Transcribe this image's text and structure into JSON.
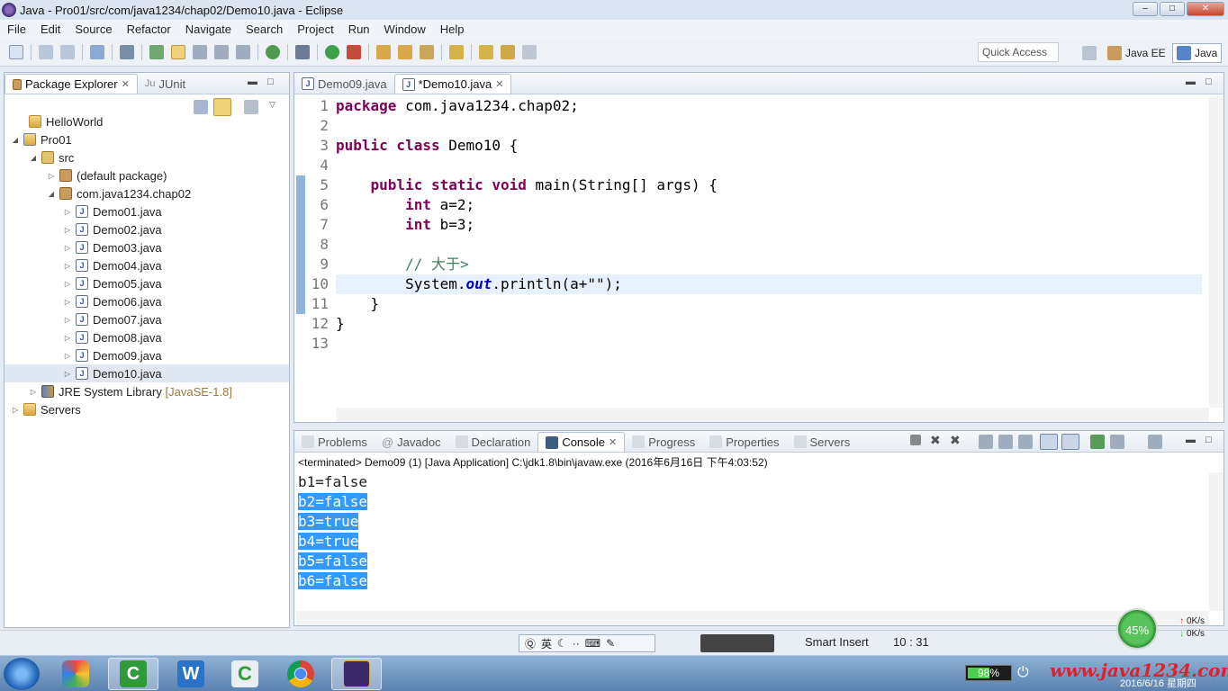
{
  "window": {
    "title": "Java - Pro01/src/com/java1234/chap02/Demo10.java - Eclipse"
  },
  "menu": [
    "File",
    "Edit",
    "Source",
    "Refactor",
    "Navigate",
    "Search",
    "Project",
    "Run",
    "Window",
    "Help"
  ],
  "toolbar": {
    "quick_access": "Quick Access",
    "perspective_javaee": "Java EE",
    "perspective_java": "Java"
  },
  "explorer": {
    "tab_package": "Package Explorer",
    "tab_junit": "JUnit",
    "nodes": {
      "helloworld": "HelloWorld",
      "pro01": "Pro01",
      "src": "src",
      "default_pkg": "(default package)",
      "pkg": "com.java1234.chap02",
      "d01": "Demo01.java",
      "d02": "Demo02.java",
      "d03": "Demo03.java",
      "d04": "Demo04.java",
      "d05": "Demo05.java",
      "d06": "Demo06.java",
      "d07": "Demo07.java",
      "d08": "Demo08.java",
      "d09": "Demo09.java",
      "d10": "Demo10.java",
      "jre": "JRE System Library",
      "jre_ver": "[JavaSE-1.8]",
      "servers": "Servers"
    }
  },
  "editor": {
    "tab1": "Demo09.java",
    "tab2": "*Demo10.java",
    "line_numbers": [
      "1",
      "2",
      "3",
      "4",
      "5",
      "6",
      "7",
      "8",
      "9",
      "10",
      "11",
      "12",
      "13"
    ],
    "code": {
      "l1_kw": "package",
      "l1_rest": " com.java1234.chap02;",
      "l3_kw": "public class",
      "l3_rest": " Demo10 {",
      "l5_kw": "public static void",
      "l5_rest": " main(String[] args) {",
      "l6_kw": "int",
      "l6_rest": " a=2;",
      "l7_kw": "int",
      "l7_rest": " b=3;",
      "l9_cm": "// 大于>",
      "l10_a": "System.",
      "l10_out": "out",
      "l10_b": ".println(a+\"\");",
      "l11": "}",
      "l12": "}"
    }
  },
  "console": {
    "tabs": {
      "problems": "Problems",
      "javadoc": "Javadoc",
      "declaration": "Declaration",
      "console": "Console",
      "progress": "Progress",
      "properties": "Properties",
      "servers": "Servers"
    },
    "info": "<terminated> Demo09 (1) [Java Application] C:\\jdk1.8\\bin\\javaw.exe (2016年6月16日 下午4:03:52)",
    "lines": [
      "b1=false",
      "b2=false",
      "b3=true",
      "b4=true",
      "b5=false",
      "b6=false"
    ]
  },
  "status": {
    "mode": "Smart Insert",
    "position": "10 : 31",
    "ime_label": "英"
  },
  "network": {
    "percent": "45%",
    "up": "0K/s",
    "down": "0K/s"
  },
  "taskbar": {
    "battery": "98%",
    "watermark": "www.java1234.com",
    "clock": "2016/6/16 星期四"
  }
}
